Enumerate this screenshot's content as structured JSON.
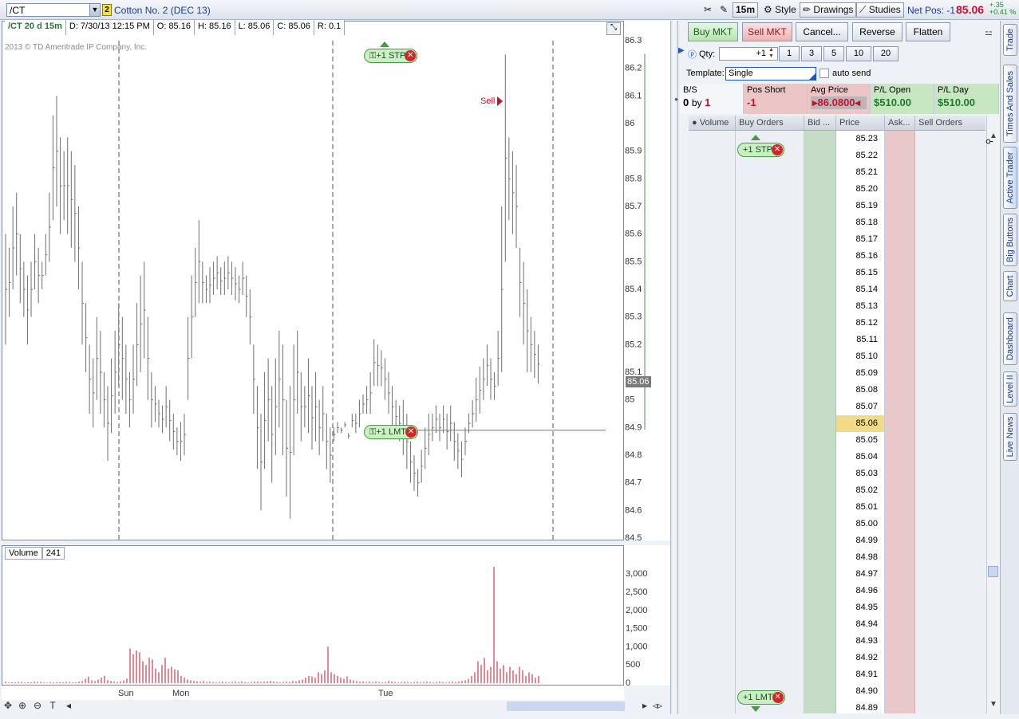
{
  "toolbar": {
    "symbol": "/CT",
    "link_group": "2",
    "instrument": "Cotton No. 2 (DEC 13)",
    "timeframe": "15m",
    "style_label": "Style",
    "drawings_label": "Drawings",
    "studies_label": "Studies",
    "net_pos_label": "Net Pos: -1",
    "last_price": "85.06",
    "change": "+.35",
    "change_pct": "+0.41 %",
    "colors": {
      "price": "#c8102e",
      "change": "#1f8a2e"
    }
  },
  "chart": {
    "info": {
      "symbol": "/CT 20 d 15m",
      "date": "D: 7/30/13 12:15 PM",
      "open": "O: 85.16",
      "high": "H: 85.16",
      "low": "L: 85.06",
      "close": "C: 85.06",
      "range": "R: 0.1"
    },
    "copyright": "2013 © TD Ameritrade IP Company, Inc.",
    "current_price_tag": "85.06",
    "sell_marker": "Sell",
    "stp_order": "+1 STP",
    "lmt_order": "+1 LMT",
    "volume_label": "Volume",
    "volume_value": "241"
  },
  "chart_data": {
    "type": "bar",
    "title": "",
    "price_axis": {
      "ticks": [
        "86.3",
        "86.2",
        "86.1",
        "86",
        "85.9",
        "85.8",
        "85.7",
        "85.6",
        "85.5",
        "85.4",
        "85.3",
        "85.2",
        "85.1",
        "85",
        "84.9",
        "84.8",
        "84.7",
        "84.6",
        "84.5"
      ],
      "ylim": [
        84.5,
        86.3
      ]
    },
    "volume_axis": {
      "ticks": [
        "3,000",
        "2,500",
        "2,000",
        "1,500",
        "1,000",
        "500",
        "0"
      ],
      "ylim": [
        0,
        3200
      ]
    },
    "time_labels": [
      "Sun",
      "Mon",
      "Tue"
    ],
    "price_series": [
      {
        "h": 85.6,
        "l": 85.2
      },
      {
        "h": 85.55,
        "l": 85.3
      },
      {
        "h": 85.7,
        "l": 85.4
      },
      {
        "h": 85.75,
        "l": 85.45
      },
      {
        "h": 85.6,
        "l": 85.35
      },
      {
        "h": 85.5,
        "l": 85.3
      },
      {
        "h": 85.45,
        "l": 85.2
      },
      {
        "h": 85.5,
        "l": 85.3
      },
      {
        "h": 85.6,
        "l": 85.4
      },
      {
        "h": 85.55,
        "l": 85.35
      },
      {
        "h": 85.5,
        "l": 85.4
      },
      {
        "h": 85.6,
        "l": 85.45
      },
      {
        "h": 85.75,
        "l": 85.5
      },
      {
        "h": 86.03,
        "l": 85.65
      },
      {
        "h": 86.1,
        "l": 85.7
      },
      {
        "h": 85.95,
        "l": 85.6
      },
      {
        "h": 85.9,
        "l": 85.65
      },
      {
        "h": 85.95,
        "l": 85.6
      },
      {
        "h": 85.9,
        "l": 85.55
      },
      {
        "h": 85.85,
        "l": 85.5
      },
      {
        "h": 85.7,
        "l": 85.4
      },
      {
        "h": 85.5,
        "l": 85.2
      },
      {
        "h": 85.35,
        "l": 85.1
      },
      {
        "h": 85.2,
        "l": 84.95
      },
      {
        "h": 85.15,
        "l": 84.9
      },
      {
        "h": 85.3,
        "l": 85.0
      },
      {
        "h": 85.25,
        "l": 84.95
      },
      {
        "h": 85.1,
        "l": 84.9
      },
      {
        "h": 85.05,
        "l": 84.78
      },
      {
        "h": 85.15,
        "l": 84.88
      },
      {
        "h": 85.25,
        "l": 84.95
      },
      {
        "h": 85.35,
        "l": 85.05
      },
      {
        "h": 85.3,
        "l": 85.0
      },
      {
        "h": 85.2,
        "l": 84.95
      },
      {
        "h": 85.1,
        "l": 84.9
      },
      {
        "h": 85.2,
        "l": 84.95
      },
      {
        "h": 85.35,
        "l": 85.05
      },
      {
        "h": 85.45,
        "l": 85.1
      },
      {
        "h": 85.5,
        "l": 85.15
      },
      {
        "h": 85.3,
        "l": 85.0
      },
      {
        "h": 85.1,
        "l": 84.9
      },
      {
        "h": 85.05,
        "l": 84.92
      },
      {
        "h": 85.0,
        "l": 84.9
      },
      {
        "h": 84.98,
        "l": 84.88
      },
      {
        "h": 85.05,
        "l": 84.9
      },
      {
        "h": 85.0,
        "l": 84.85
      },
      {
        "h": 84.95,
        "l": 84.82
      },
      {
        "h": 84.9,
        "l": 84.8
      },
      {
        "h": 84.92,
        "l": 84.78
      },
      {
        "h": 84.95,
        "l": 84.8
      },
      {
        "h": 85.3,
        "l": 85.0
      },
      {
        "h": 85.45,
        "l": 85.15
      },
      {
        "h": 85.55,
        "l": 85.3
      },
      {
        "h": 85.65,
        "l": 85.35
      },
      {
        "h": 85.5,
        "l": 85.35
      },
      {
        "h": 85.45,
        "l": 85.35
      },
      {
        "h": 85.48,
        "l": 85.35
      },
      {
        "h": 85.5,
        "l": 85.38
      },
      {
        "h": 85.52,
        "l": 85.4
      },
      {
        "h": 85.48,
        "l": 85.38
      },
      {
        "h": 85.5,
        "l": 85.38
      },
      {
        "h": 85.52,
        "l": 85.4
      },
      {
        "h": 85.5,
        "l": 85.38
      },
      {
        "h": 85.48,
        "l": 85.36
      },
      {
        "h": 85.45,
        "l": 85.35
      },
      {
        "h": 85.5,
        "l": 85.38
      },
      {
        "h": 85.45,
        "l": 85.3
      },
      {
        "h": 85.4,
        "l": 85.2
      },
      {
        "h": 85.2,
        "l": 84.95
      },
      {
        "h": 85.05,
        "l": 84.75
      },
      {
        "h": 84.95,
        "l": 84.6
      },
      {
        "h": 85.1,
        "l": 84.75
      },
      {
        "h": 85.15,
        "l": 84.85
      },
      {
        "h": 85.05,
        "l": 84.7
      },
      {
        "h": 85.15,
        "l": 84.8
      },
      {
        "h": 85.25,
        "l": 84.9
      },
      {
        "h": 85.2,
        "l": 84.8
      },
      {
        "h": 85.0,
        "l": 84.65
      },
      {
        "h": 85.05,
        "l": 84.57
      },
      {
        "h": 85.2,
        "l": 84.8
      },
      {
        "h": 85.25,
        "l": 84.95
      },
      {
        "h": 85.1,
        "l": 84.85
      },
      {
        "h": 85.05,
        "l": 84.9
      },
      {
        "h": 85.15,
        "l": 84.88
      },
      {
        "h": 85.05,
        "l": 84.82
      },
      {
        "h": 85.1,
        "l": 84.85
      },
      {
        "h": 85.0,
        "l": 84.8
      },
      {
        "h": 85.05,
        "l": 84.85
      },
      {
        "h": 84.95,
        "l": 84.75
      },
      {
        "h": 84.9,
        "l": 84.7
      },
      {
        "h": 84.9,
        "l": 84.85
      },
      {
        "h": 84.92,
        "l": 84.88
      },
      {
        "h": 84.9,
        "l": 84.88
      },
      {
        "h": 84.92,
        "l": 84.9
      },
      {
        "h": 84.88,
        "l": 84.86
      },
      {
        "h": 84.95,
        "l": 84.9
      },
      {
        "h": 84.95,
        "l": 84.88
      },
      {
        "h": 85.0,
        "l": 84.9
      },
      {
        "h": 85.02,
        "l": 84.95
      },
      {
        "h": 85.05,
        "l": 84.95
      },
      {
        "h": 85.1,
        "l": 84.95
      },
      {
        "h": 85.22,
        "l": 85.05
      },
      {
        "h": 85.2,
        "l": 85.05
      },
      {
        "h": 85.18,
        "l": 85.05
      },
      {
        "h": 85.15,
        "l": 85.0
      },
      {
        "h": 85.1,
        "l": 84.95
      },
      {
        "h": 85.05,
        "l": 84.9
      },
      {
        "h": 85.0,
        "l": 84.88
      },
      {
        "h": 84.98,
        "l": 84.85
      },
      {
        "h": 85.0,
        "l": 84.8
      },
      {
        "h": 84.95,
        "l": 84.75
      },
      {
        "h": 84.85,
        "l": 84.7
      },
      {
        "h": 84.8,
        "l": 84.67
      },
      {
        "h": 84.75,
        "l": 84.65
      },
      {
        "h": 84.82,
        "l": 84.7
      },
      {
        "h": 84.9,
        "l": 84.75
      },
      {
        "h": 84.95,
        "l": 84.8
      },
      {
        "h": 84.95,
        "l": 84.85
      },
      {
        "h": 84.98,
        "l": 84.88
      },
      {
        "h": 84.95,
        "l": 84.85
      },
      {
        "h": 84.98,
        "l": 84.88
      },
      {
        "h": 84.95,
        "l": 84.82
      },
      {
        "h": 84.98,
        "l": 84.85
      },
      {
        "h": 84.92,
        "l": 84.78
      },
      {
        "h": 84.88,
        "l": 84.75
      },
      {
        "h": 84.85,
        "l": 84.72
      },
      {
        "h": 84.9,
        "l": 84.8
      },
      {
        "h": 84.95,
        "l": 84.88
      },
      {
        "h": 85.0,
        "l": 84.9
      },
      {
        "h": 85.08,
        "l": 84.92
      },
      {
        "h": 85.12,
        "l": 84.95
      },
      {
        "h": 85.15,
        "l": 85.0
      },
      {
        "h": 85.2,
        "l": 85.05
      },
      {
        "h": 85.15,
        "l": 85.0
      },
      {
        "h": 85.1,
        "l": 85.0
      },
      {
        "h": 85.25,
        "l": 85.05
      },
      {
        "h": 85.7,
        "l": 85.1
      },
      {
        "h": 86.25,
        "l": 85.5
      },
      {
        "h": 85.95,
        "l": 85.65
      },
      {
        "h": 85.9,
        "l": 85.6
      },
      {
        "h": 85.85,
        "l": 85.55
      },
      {
        "h": 85.55,
        "l": 85.3
      },
      {
        "h": 85.5,
        "l": 85.2
      },
      {
        "h": 85.4,
        "l": 85.1
      },
      {
        "h": 85.3,
        "l": 85.1
      },
      {
        "h": 85.25,
        "l": 85.08
      },
      {
        "h": 85.2,
        "l": 85.06
      }
    ],
    "volume_series": [
      40,
      20,
      30,
      25,
      35,
      30,
      20,
      30,
      25,
      40,
      30,
      35,
      20,
      15,
      30,
      25,
      30,
      30,
      25,
      35,
      30,
      20,
      25,
      40,
      60,
      120,
      180,
      80,
      60,
      100,
      150,
      200,
      80,
      60,
      40,
      30,
      50,
      70,
      120,
      950,
      800,
      900,
      850,
      600,
      500,
      700,
      650,
      400,
      300,
      500,
      700,
      400,
      450,
      380,
      350,
      200,
      150,
      100,
      80,
      60,
      50,
      40,
      60,
      30,
      40,
      30,
      20,
      30,
      40,
      30,
      20,
      30,
      40,
      30,
      50,
      30,
      20,
      30,
      40,
      50,
      30,
      40,
      50,
      60,
      40,
      30,
      20,
      30,
      40,
      30,
      60,
      50,
      80,
      100,
      150,
      200,
      180,
      150,
      300,
      250,
      350,
      1000,
      300,
      250,
      200,
      150,
      120,
      180,
      100,
      80,
      60,
      40,
      50,
      30,
      40,
      30,
      40,
      30,
      20,
      30,
      60,
      40,
      30,
      20,
      30,
      40,
      30,
      20,
      30,
      40,
      20,
      30,
      40,
      30,
      20,
      30,
      40,
      30,
      20,
      30,
      40,
      30,
      50,
      60,
      80,
      120,
      200,
      300,
      600,
      500,
      700,
      350,
      450,
      3200,
      600,
      400,
      500,
      300,
      450,
      350,
      250,
      450,
      350,
      200,
      300,
      250,
      150,
      200
    ],
    "colors": {
      "bars": "#6e6e6e",
      "volume": "#c8102e",
      "limit_line": "#4a9a44"
    }
  },
  "trader": {
    "buttons": {
      "buy_mkt": "Buy MKT",
      "sell_mkt": "Sell MKT",
      "cancel": "Cancel...",
      "reverse": "Reverse",
      "flatten": "Flatten"
    },
    "qty_label": "Qty:",
    "qty_value": "+1",
    "qty_presets": [
      "1",
      "3",
      "5",
      "10",
      "20"
    ],
    "template_label": "Template:",
    "template_value": "Single",
    "auto_send_label": "auto send",
    "position": {
      "bs_label": "B/S",
      "bs_value_prefix": "0",
      "bs_value_by": "by",
      "bs_value_suffix": "1",
      "pos_short_label": "Pos Short",
      "pos_short_value": "-1",
      "avg_price_label": "Avg Price",
      "avg_price_value": "86.0800",
      "pl_open_label": "P/L Open",
      "pl_open_value": "$510.00",
      "pl_day_label": "P/L Day",
      "pl_day_value": "$510.00"
    },
    "ladder_headers": [
      "Volume",
      "Buy Orders",
      "Bid ...",
      "Price",
      "Ask...",
      "Sell Orders"
    ],
    "prices": [
      "85.23",
      "85.22",
      "85.21",
      "85.20",
      "85.19",
      "85.18",
      "85.17",
      "85.16",
      "85.15",
      "85.14",
      "85.13",
      "85.12",
      "85.11",
      "85.10",
      "85.09",
      "85.08",
      "85.07",
      "85.06",
      "85.05",
      "85.04",
      "85.03",
      "85.02",
      "85.01",
      "85.00",
      "84.99",
      "84.98",
      "84.97",
      "84.96",
      "84.95",
      "84.94",
      "84.93",
      "84.92",
      "84.91",
      "84.90",
      "84.89"
    ],
    "current_price": "85.06",
    "stp_order": "+1 STP",
    "lmt_order": "+1 LMT"
  },
  "side_tabs": [
    "Trade",
    "Times And Sales",
    "Active Trader",
    "Big Buttons",
    "Chart",
    "Dashboard",
    "Level II",
    "Live News"
  ]
}
